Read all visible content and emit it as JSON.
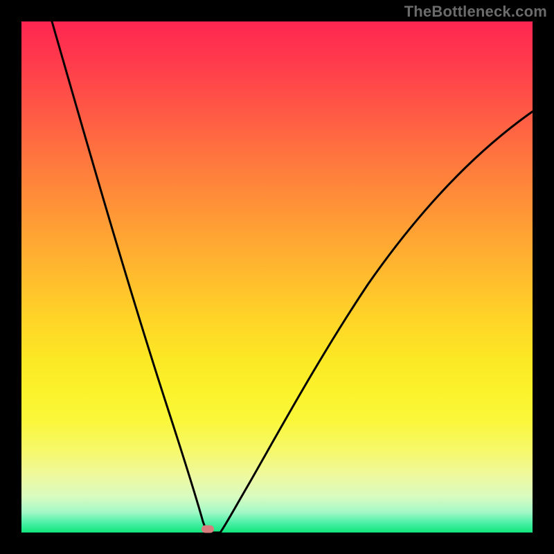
{
  "watermark": "TheBottleneck.com",
  "marker": {
    "x_fraction": 0.365,
    "y_fraction": 0.995
  },
  "chart_data": {
    "type": "line",
    "title": "",
    "xlabel": "",
    "ylabel": "",
    "xlim": [
      0,
      1
    ],
    "ylim": [
      0,
      1
    ],
    "background": "rainbow-gradient (red top → green bottom), black frame",
    "annotations": [
      {
        "text": "TheBottleneck.com",
        "position": "top-right"
      }
    ],
    "series": [
      {
        "name": "left-branch",
        "x": [
          0.06,
          0.1,
          0.14,
          0.18,
          0.22,
          0.26,
          0.29,
          0.31,
          0.33,
          0.345,
          0.355,
          0.36
        ],
        "values": [
          1.0,
          0.87,
          0.735,
          0.6,
          0.46,
          0.32,
          0.205,
          0.13,
          0.07,
          0.03,
          0.01,
          0.0
        ]
      },
      {
        "name": "right-branch",
        "x": [
          0.39,
          0.42,
          0.46,
          0.51,
          0.57,
          0.64,
          0.72,
          0.8,
          0.88,
          0.95,
          1.0
        ],
        "values": [
          0.0,
          0.04,
          0.105,
          0.195,
          0.305,
          0.425,
          0.545,
          0.645,
          0.73,
          0.79,
          0.825
        ]
      }
    ],
    "markers": [
      {
        "name": "bottleneck-point",
        "x": 0.365,
        "y": 0.005,
        "color": "#d77d7d"
      }
    ]
  }
}
